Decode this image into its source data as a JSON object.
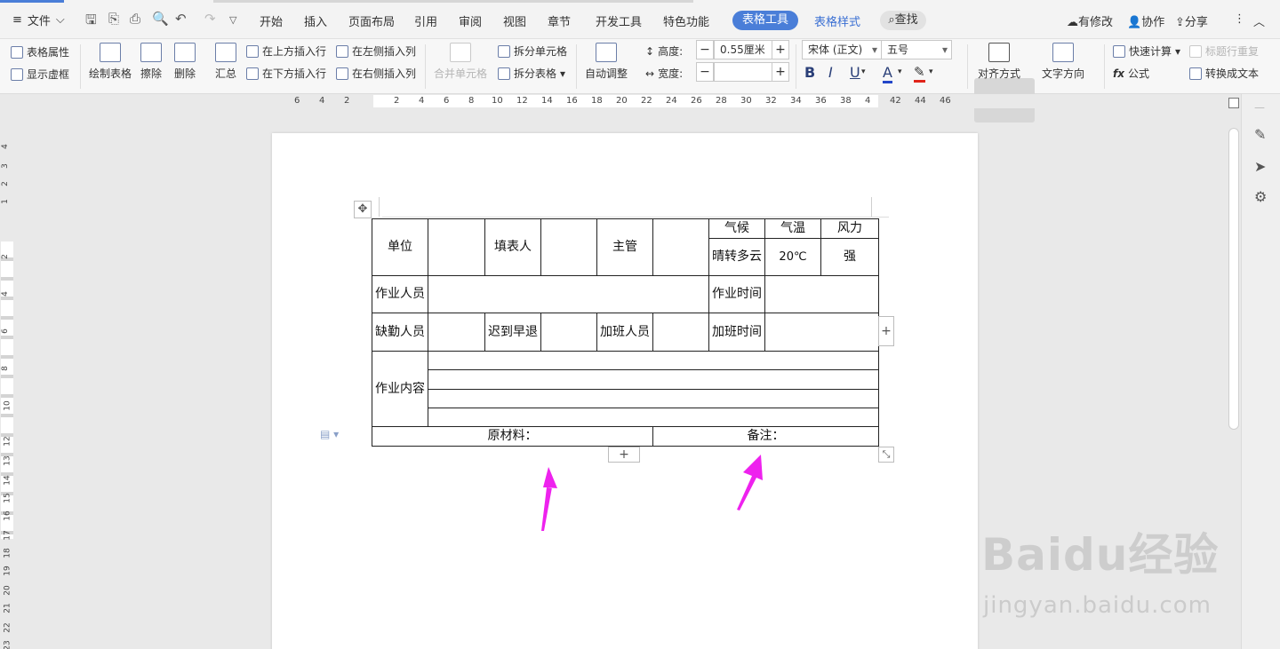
{
  "titlebar": {
    "file_menu": "文件",
    "tabs": [
      "开始",
      "插入",
      "页面布局",
      "引用",
      "审阅",
      "视图",
      "章节",
      "开发工具",
      "特色功能"
    ],
    "active_tab": "表格工具",
    "context_tab": "表格样式",
    "search": "查找",
    "right_actions": [
      "有修改",
      "协作",
      "分享"
    ]
  },
  "ribbon": {
    "table_props": "表格属性",
    "show_gridlines": "显示虚框",
    "draw_table": "绘制表格",
    "erase": "擦除",
    "delete": "删除",
    "summary": "汇总",
    "insert_above": "在上方插入行",
    "insert_below": "在下方插入行",
    "insert_left": "在左侧插入列",
    "insert_right": "在右侧插入列",
    "merge_cells": "合并单元格",
    "split_cells": "拆分单元格",
    "split_table": "拆分表格",
    "auto_fit": "自动调整",
    "height_label": "高度:",
    "height_value": "0.55厘米",
    "width_label": "宽度:",
    "width_value": "",
    "font_name": "宋体 (正文)",
    "font_size": "五号",
    "bold": "B",
    "italic": "I",
    "underline": "U",
    "font_color": "A",
    "align": "对齐方式",
    "text_direction": "文字方向",
    "quick_calc": "快速计算",
    "formula": "公式",
    "repeat_header": "标题行重复",
    "to_text": "转换成文本"
  },
  "ruler": {
    "h_ticks": [
      "6",
      "4",
      "2",
      "2",
      "4",
      "6",
      "8",
      "10",
      "12",
      "14",
      "16",
      "18",
      "20",
      "22",
      "24",
      "26",
      "28",
      "30",
      "32",
      "34",
      "36",
      "38",
      "4",
      "42",
      "44",
      "46"
    ],
    "v_ticks": [
      "4",
      "3",
      "2",
      "1",
      "2",
      "4",
      "6",
      "8",
      "10",
      "12",
      "13",
      "14",
      "15",
      "16",
      "17",
      "18",
      "19",
      "20",
      "21",
      "22",
      "23"
    ]
  },
  "table": {
    "unit": "单位",
    "filler": "填表人",
    "supervisor": "主管",
    "weather": "气候",
    "temperature": "气温",
    "wind": "风力",
    "weather_value": "晴转多云",
    "temperature_value": "20℃",
    "wind_value": "强",
    "workers": "作业人员",
    "work_time": "作业时间",
    "absent": "缺勤人员",
    "late_early": "迟到早退",
    "overtime_staff": "加班人员",
    "overtime_time": "加班时间",
    "work_content": "作业内容",
    "materials": "原材料：",
    "remarks": "备注："
  },
  "watermark": {
    "logo": "Baidu经验",
    "url": "jingyan.baidu.com"
  },
  "colors": {
    "accent": "#4a7ed8",
    "arrow": "#ee22ee"
  }
}
